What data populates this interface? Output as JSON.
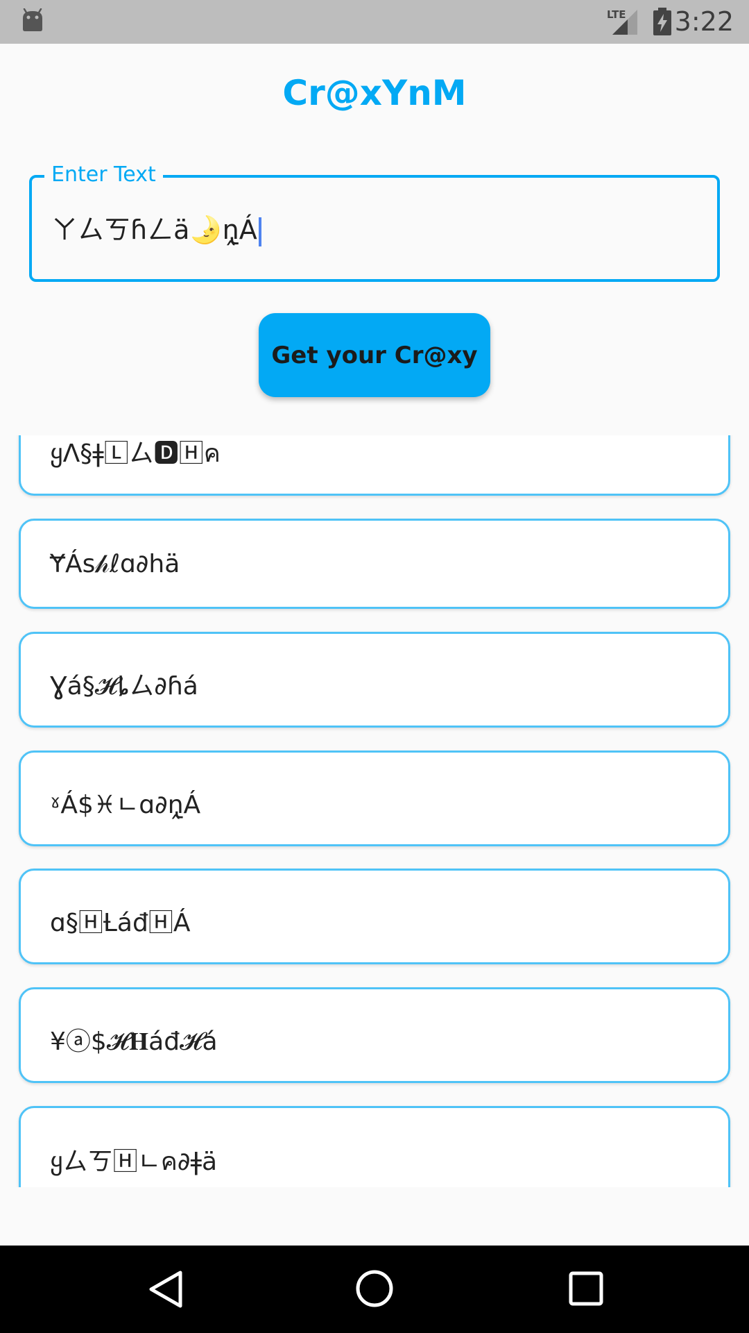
{
  "status_bar": {
    "time": "3:22",
    "network_label": "LTE",
    "icons": [
      "android-icon",
      "lte-signal-icon",
      "battery-charging-icon"
    ]
  },
  "app": {
    "title": "Cr@xYnM"
  },
  "input": {
    "label": "Enter Text",
    "value": "ㄚㄙㄎɦㄥä🌛ṋ̢Á"
  },
  "button": {
    "label": "Get your Cr@xy"
  },
  "results": [
    "ყΛ§ǂ🄻ㄙ🅳🄷ค",
    "ɎÁs𝒽ℓɑ∂hä",
    "Ɣá§𝓗ȴㄙ∂ɦá",
    "ˠÁ$♓ㄴɑ∂ṋ̢Á",
    "ɑ§🄷Ƚáđ🄷Á",
    "¥ⓐ$𝓗𝐇áđ𝓗á",
    "ყㄙㄎ🄷ㄴค∂ǂä"
  ],
  "nav_bar": {
    "icons": [
      "back-icon",
      "home-icon",
      "recent-apps-icon"
    ]
  },
  "colors": {
    "accent": "#03a9f4",
    "card_border": "#4fc3f7",
    "status_bar": "#bdbdbd",
    "nav_bar": "#000000",
    "cursor": "#4f83f0"
  }
}
